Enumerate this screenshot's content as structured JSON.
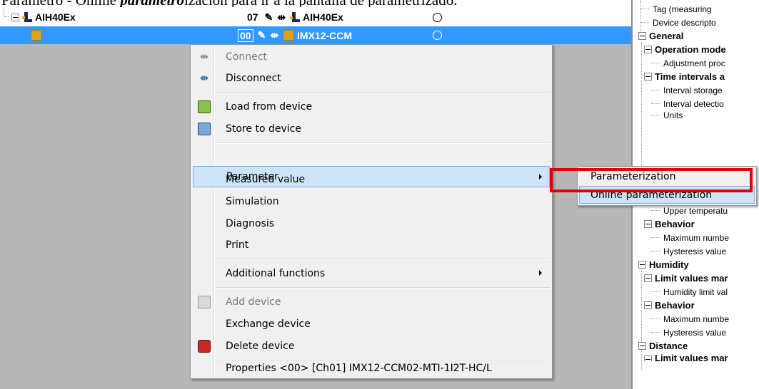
{
  "caption": {
    "prefix": "Parámetro",
    "middle": " - Online ",
    "bold_italic": "parámetro",
    "suffix": "ización para ir a la pantalla de parametrizado."
  },
  "tree": {
    "rows": [
      {
        "name": "AIH40Ex",
        "address": "07",
        "device": "AIH40Ex",
        "selected": false
      },
      {
        "name": "",
        "address": "00",
        "device": "IMX12-CCM",
        "selected": true
      }
    ]
  },
  "context_menu": {
    "items": [
      {
        "label": "Connect",
        "icon": "connect-icon",
        "disabled": true
      },
      {
        "label": "Disconnect",
        "icon": "disconnect-icon",
        "disabled": false
      },
      {
        "label": "Load from device",
        "icon": "load-from-device-icon",
        "disabled": false
      },
      {
        "label": "Store to device",
        "icon": "store-to-device-icon",
        "disabled": false
      },
      {
        "label": "Parameter",
        "submenu": true,
        "highlighted": true
      },
      {
        "label": "Measured value"
      },
      {
        "label": "Simulation"
      },
      {
        "label": "Diagnosis"
      },
      {
        "label": "Print"
      },
      {
        "label": "Additional functions",
        "submenu": true
      },
      {
        "label": "Add device",
        "icon": "add-device-icon",
        "disabled": true
      },
      {
        "label": "Exchange device"
      },
      {
        "label": "Delete device",
        "icon": "delete-device-icon"
      },
      {
        "label": "Properties <00> [Ch01] IMX12-CCM02-MTI-1I2T-HC/L"
      }
    ]
  },
  "submenu": {
    "items": [
      {
        "label": "Parameterization",
        "highlighted": false
      },
      {
        "label": "Online parameterization",
        "highlighted": true
      }
    ]
  },
  "highlight_color": "#e10000",
  "properties": {
    "rows": [
      "Tag (measuring",
      "Device descripto",
      "General",
      "Operation mode",
      "Adjustment proc",
      "Time intervals a",
      "Interval storage",
      "Interval detectio",
      "Units",
      "Upper temperatu",
      "Behavior",
      "Maximum numbe",
      "Hysteresis value",
      "Humidity",
      "Limit values mar",
      "Humidity limit val",
      "Behavior",
      "Maximum numbe",
      "Hysteresis value",
      "Distance",
      "Limit values mar"
    ]
  }
}
